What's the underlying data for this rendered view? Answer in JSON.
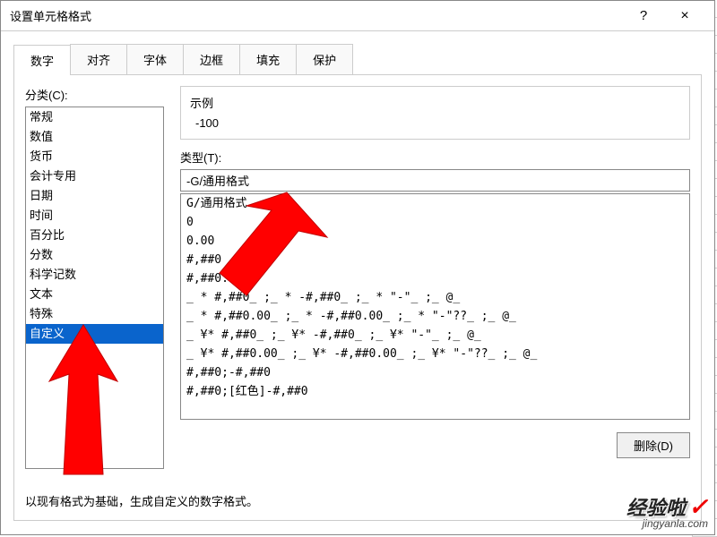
{
  "titlebar": {
    "title": "设置单元格格式",
    "help": "?",
    "close": "×"
  },
  "tabs": [
    "数字",
    "对齐",
    "字体",
    "边框",
    "填充",
    "保护"
  ],
  "active_tab_index": 0,
  "category": {
    "label": "分类(C):",
    "items": [
      "常规",
      "数值",
      "货币",
      "会计专用",
      "日期",
      "时间",
      "百分比",
      "分数",
      "科学记数",
      "文本",
      "特殊",
      "自定义"
    ],
    "selected_index": 11
  },
  "example": {
    "label": "示例",
    "value": "-100"
  },
  "type_section": {
    "label": "类型(T):",
    "input_value": "-G/通用格式",
    "items": [
      "G/通用格式",
      "0",
      "0.00",
      "#,##0",
      "#,##0.00",
      "_ * #,##0_ ;_ * -#,##0_ ;_ * \"-\"_ ;_ @_ ",
      "_ * #,##0.00_ ;_ * -#,##0.00_ ;_ * \"-\"??_ ;_ @_ ",
      "_ ¥* #,##0_ ;_ ¥* -#,##0_ ;_ ¥* \"-\"_ ;_ @_ ",
      "_ ¥* #,##0.00_ ;_ ¥* -#,##0.00_ ;_ ¥* \"-\"??_ ;_ @_ ",
      "#,##0;-#,##0",
      "#,##0;[红色]-#,##0"
    ]
  },
  "delete_btn": "删除(D)",
  "hint": "以现有格式为基础，生成自定义的数字格式。",
  "watermark": {
    "main": "经验啦",
    "sub": "jingyanla.com"
  }
}
